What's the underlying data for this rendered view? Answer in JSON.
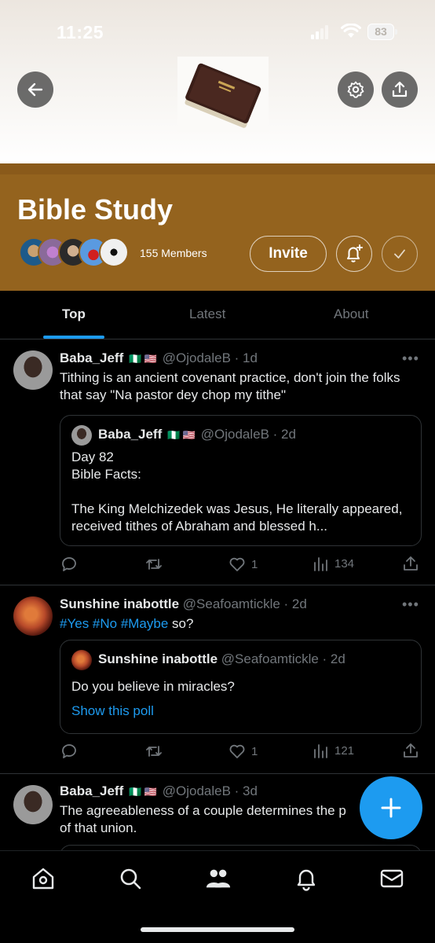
{
  "status_bar": {
    "time": "11:25",
    "battery": "83"
  },
  "community": {
    "title": "Bible Study",
    "members": "155 Members",
    "invite_label": "Invite"
  },
  "tabs": [
    {
      "label": "Top"
    },
    {
      "label": "Latest"
    },
    {
      "label": "About"
    }
  ],
  "posts": [
    {
      "name": "Baba_Jeff",
      "flags": "🇳🇬 🇺🇸",
      "handle": "@OjodaleB · 1d",
      "text": "Tithing is an ancient covenant practice, don't join the folks that say \"Na pastor dey chop my tithe\"",
      "quote": {
        "name": "Baba_Jeff",
        "flags": "🇳🇬 🇺🇸",
        "handle": "@OjodaleB · 2d",
        "line1": "Day 82",
        "line2": "Bible Facts:",
        "line3": "The King Melchizedek was Jesus, He literally appeared, received tithes of Abraham and blessed h..."
      },
      "likes": "1",
      "views": "134"
    },
    {
      "name": "Sunshine inabottle",
      "handle": "@Seafoamtickle · 2d",
      "hashtags": "#Yes #No #Maybe",
      "text_after": " so?",
      "quote": {
        "name": "Sunshine inabottle",
        "handle": "@Seafoamtickle · 2d",
        "text": "Do you believe in miracles?",
        "link": "Show this poll"
      },
      "likes": "1",
      "views": "121"
    },
    {
      "name": "Baba_Jeff",
      "flags": "🇳🇬 🇺🇸",
      "handle": "@OjodaleB · 3d",
      "text": "The agreeableness of a couple determines the p",
      "text2": "of that union."
    }
  ],
  "colors": {
    "accent": "#1d9bf0",
    "community_band": "#94631e",
    "background": "#000000"
  },
  "icons": [
    "back-arrow-icon",
    "gear-icon",
    "share-icon",
    "bell-plus-icon",
    "check-icon",
    "reply-icon",
    "retweet-icon",
    "heart-icon",
    "views-icon",
    "plus-icon",
    "home-icon",
    "search-icon",
    "communities-icon",
    "notifications-icon",
    "mail-icon"
  ]
}
